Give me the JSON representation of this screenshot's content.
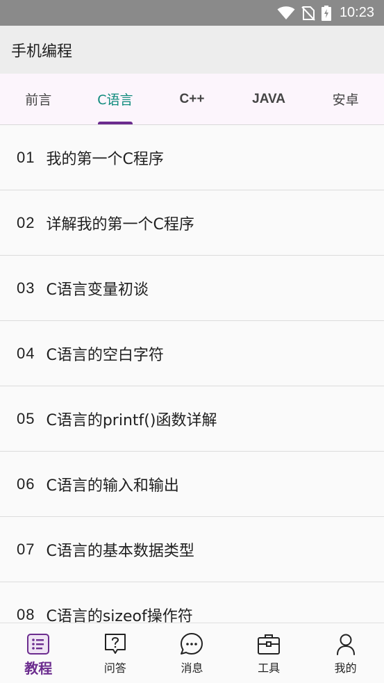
{
  "status_bar": {
    "time": "10:23"
  },
  "app_bar": {
    "title": "手机编程"
  },
  "tabs": [
    {
      "label": "前言"
    },
    {
      "label": "C语言"
    },
    {
      "label": "C++"
    },
    {
      "label": "JAVA"
    },
    {
      "label": "安卓"
    }
  ],
  "active_tab": "C语言",
  "lessons": [
    {
      "num": "01",
      "title": "我的第一个C程序"
    },
    {
      "num": "02",
      "title": "详解我的第一个C程序"
    },
    {
      "num": "03",
      "title": "C语言变量初谈"
    },
    {
      "num": "04",
      "title": "C语言的空白字符"
    },
    {
      "num": "05",
      "title": "C语言的printf()函数详解"
    },
    {
      "num": "06",
      "title": "C语言的输入和输出"
    },
    {
      "num": "07",
      "title": "C语言的基本数据类型"
    },
    {
      "num": "08",
      "title": "C语言的sizeof操作符"
    }
  ],
  "bottom_nav": [
    {
      "label": "教程",
      "icon": "list-doc-icon",
      "active": true
    },
    {
      "label": "问答",
      "icon": "question-icon",
      "active": false
    },
    {
      "label": "消息",
      "icon": "chat-bubble-icon",
      "active": false
    },
    {
      "label": "工具",
      "icon": "toolbox-icon",
      "active": false
    },
    {
      "label": "我的",
      "icon": "person-icon",
      "active": false
    }
  ],
  "colors": {
    "accent": "#6b2c8e",
    "active_tab_text": "#0e8a7c",
    "status_bar": "#8a8a8a"
  }
}
